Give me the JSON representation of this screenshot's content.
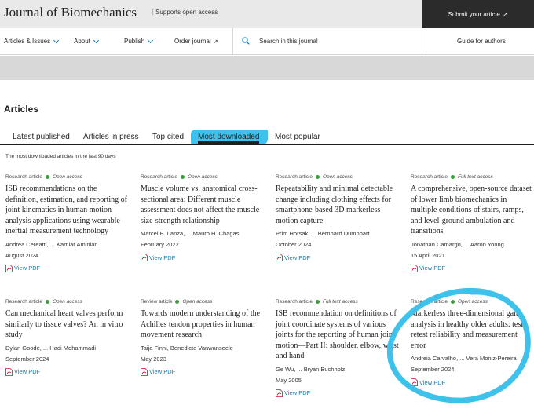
{
  "header": {
    "journal_title": "Journal of Biomechanics",
    "open_access_note": "Supports open access",
    "submit_button": "Submit your article",
    "submit_arrow": "↗"
  },
  "nav": {
    "articles_issues": "Articles & Issues",
    "about": "About",
    "publish": "Publish",
    "order_journal": "Order journal",
    "order_arrow": "↗",
    "search_placeholder": "Search in this journal",
    "guide_for_authors": "Guide for authors"
  },
  "section_title": "Articles",
  "tabs": {
    "latest": "Latest published",
    "in_press": "Articles in press",
    "top_cited": "Top cited",
    "most_downloaded": "Most downloaded",
    "most_popular": "Most popular",
    "active": "Most downloaded"
  },
  "subnote": "The most downloaded articles in the last 90 days",
  "pdf_label": "View PDF",
  "colors": {
    "highlight": "#3ec1ea",
    "link": "#0c7dbb",
    "open_access_dot": "#3e9a3e",
    "header_dark": "#2b2b2b"
  },
  "articles": [
    {
      "type": "Research article",
      "access": "Open access",
      "title": "ISB recommendations on the definition, estimation, and reporting of joint kinematics in human motion analysis applications using wearable inertial measurement technology",
      "authors": "Andrea Cereatti, ... Kamiar Aminian",
      "date": "August 2024"
    },
    {
      "type": "Research article",
      "access": "Open access",
      "title": "Muscle volume vs. anatomical cross-sectional area: Different muscle assessment does not affect the muscle size-strength relationship",
      "authors": "Marcel B. Lanza, ... Mauro H. Chagas",
      "date": "February 2022"
    },
    {
      "type": "Research article",
      "access": "Open access",
      "title": "Repeatability and minimal detectable change including clothing effects for smartphone-based 3D markerless motion capture",
      "authors": "Prim Horsak, ... Bernhard Dumphart",
      "date": "October 2024"
    },
    {
      "type": "Research article",
      "access": "Full text access",
      "title": "A comprehensive, open-source dataset of lower limb biomechanics in multiple conditions of stairs, ramps, and level-ground ambulation and transitions",
      "authors": "Jonathan Camargo, ... Aaron Young",
      "date": "15 April 2021"
    },
    {
      "type": "Research article",
      "access": "Open access",
      "title": "Can mechanical heart valves perform similarly to tissue valves? An in vitro study",
      "authors": "Dylan Goode, ... Hadi Mohammadi",
      "date": "September 2024"
    },
    {
      "type": "Review article",
      "access": "Open access",
      "title": "Towards modern understanding of the Achilles tendon properties in human movement research",
      "authors": "Taija Finni, Benedicte Vanwanseele",
      "date": "May 2023"
    },
    {
      "type": "Research article",
      "access": "Full text access",
      "title": "ISB recommendation on definitions of joint coordinate systems of various joints for the reporting of human joint motion—Part II: shoulder, elbow, wrist and hand",
      "authors": "Ge Wu, ... Bryan Buchholz",
      "date": "May 2005"
    },
    {
      "type": "Research article",
      "access": "Open access",
      "title": "Markerless three-dimensional gait analysis in healthy older adults: test-retest reliability and measurement error",
      "authors": "Andreia Carvalho, ... Vera Moniz-Pereira",
      "date": "September 2024"
    }
  ]
}
